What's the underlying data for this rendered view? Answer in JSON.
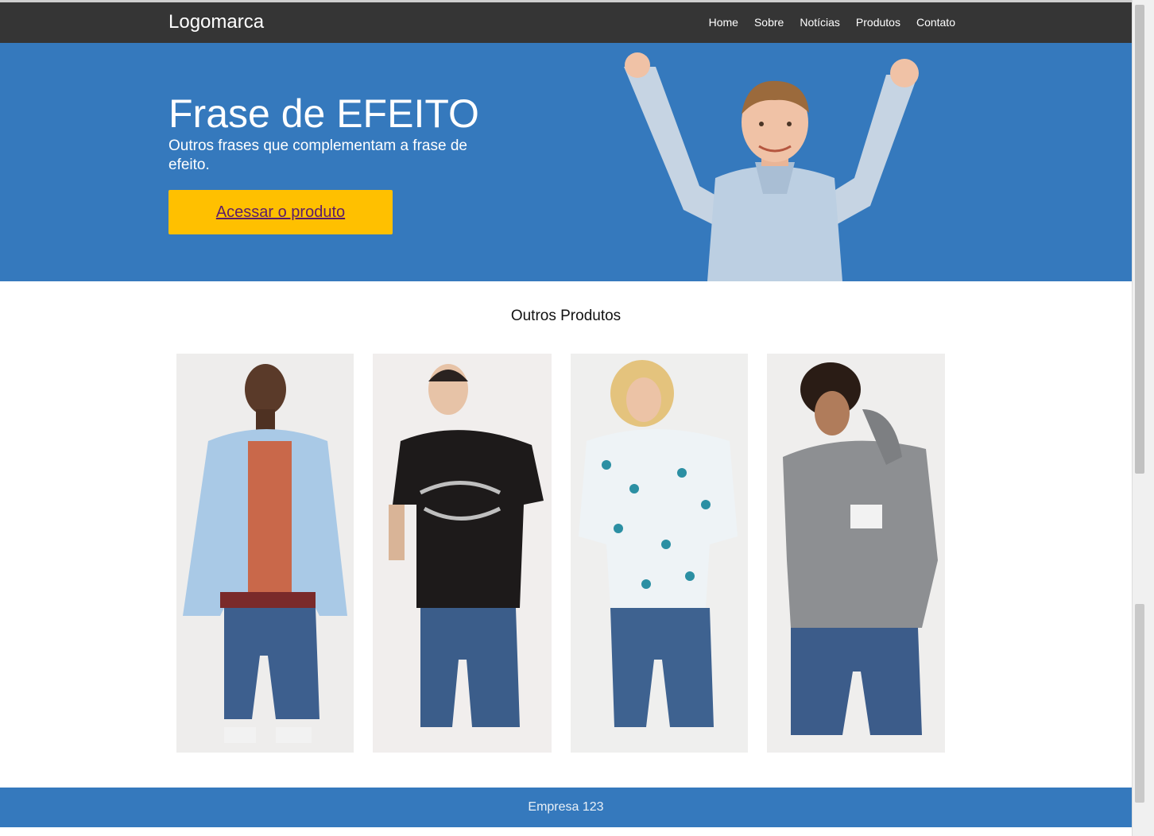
{
  "navbar": {
    "logo": "Logomarca",
    "links": [
      "Home",
      "Sobre",
      "Notícias",
      "Produtos",
      "Contato"
    ]
  },
  "hero": {
    "title": "Frase de EFEITO",
    "subtitle": "Outros frases que complementam a frase de efeito.",
    "cta_label": "Acessar o produto"
  },
  "products": {
    "title": "Outros Produtos",
    "items": [
      {
        "image": "product-photo-1"
      },
      {
        "image": "product-photo-2"
      },
      {
        "image": "product-photo-3"
      },
      {
        "image": "product-photo-4"
      }
    ]
  },
  "footer": {
    "text": "Empresa 123"
  },
  "colors": {
    "navbar": "#353535",
    "hero": "#3579bd",
    "cta": "#ffc000",
    "footer": "#3579bd"
  }
}
